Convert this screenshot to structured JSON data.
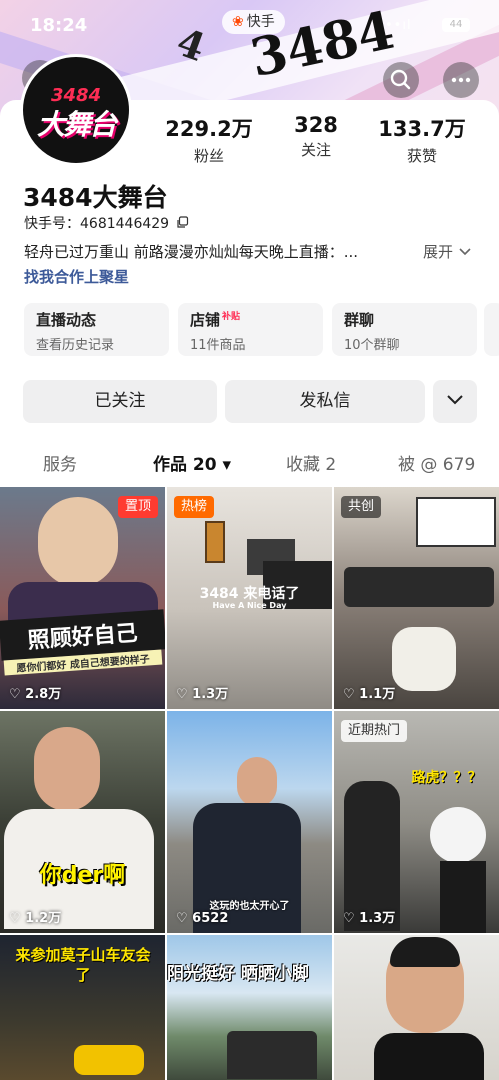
{
  "status_bar": {
    "time": "18:24",
    "app_name": "快手",
    "signal": "••ıl",
    "battery": "44"
  },
  "hero": {
    "number": "3484",
    "digit": "4"
  },
  "nav": {
    "back_icon": "chevron-left-icon",
    "search_icon": "search-icon",
    "more_icon": "more-icon"
  },
  "profile": {
    "avatar_top": "3484",
    "avatar_main": "大舞台",
    "stats": [
      {
        "value": "229.2万",
        "label": "粉丝"
      },
      {
        "value": "328",
        "label": "关注"
      },
      {
        "value": "133.7万",
        "label": "获赞"
      }
    ],
    "nickname": "3484大舞台",
    "ks_id_label": "快手号：4681446429",
    "bio": "轻舟已过万重山 前路漫漫亦灿灿每天晚上直播：...",
    "bio_expand": "展开",
    "bio_link": "找我合作上聚星"
  },
  "info_boxes": [
    {
      "title": "直播动态",
      "sub": "查看历史记录"
    },
    {
      "title": "店铺",
      "hot": "补贴",
      "sub": "11件商品"
    },
    {
      "title": "群聊",
      "sub": "10个群聊"
    }
  ],
  "actions": {
    "follow": "已关注",
    "message": "发私信",
    "dropdown_icon": "chevron-down-icon"
  },
  "tabs": [
    {
      "label": "服务"
    },
    {
      "label": "作品 20 ▾"
    },
    {
      "label": "收藏 2"
    },
    {
      "label": "被 @ 679"
    }
  ],
  "colors": {
    "accent": "#ff4906",
    "pin_badge": "#ff3b30",
    "hot_badge": "#ff6a00",
    "link": "#3d5a99"
  },
  "videos": [
    {
      "badge": "置顶",
      "caption": "照顾好自己",
      "sub": "愿你们都好 成自己想要的样子",
      "likes": "♡ 2.8万"
    },
    {
      "badge": "热榜",
      "caption": "3484 来电话了",
      "sub": "Have A Nice Day",
      "likes": "♡ 1.3万"
    },
    {
      "badge": "共创",
      "caption": "",
      "likes": "♡ 1.1万"
    },
    {
      "caption": "你der啊",
      "likes": "♡ 1.2万"
    },
    {
      "caption": "这玩的也太开心了",
      "likes": "♡ 6522"
    },
    {
      "badge": "近期热门",
      "caption": "路虎？？？",
      "likes": "♡ 1.3万"
    },
    {
      "caption": "来参加莫子山车友会了"
    },
    {
      "caption": "阳光挺好 晒晒小脚"
    },
    {
      "caption": ""
    }
  ]
}
